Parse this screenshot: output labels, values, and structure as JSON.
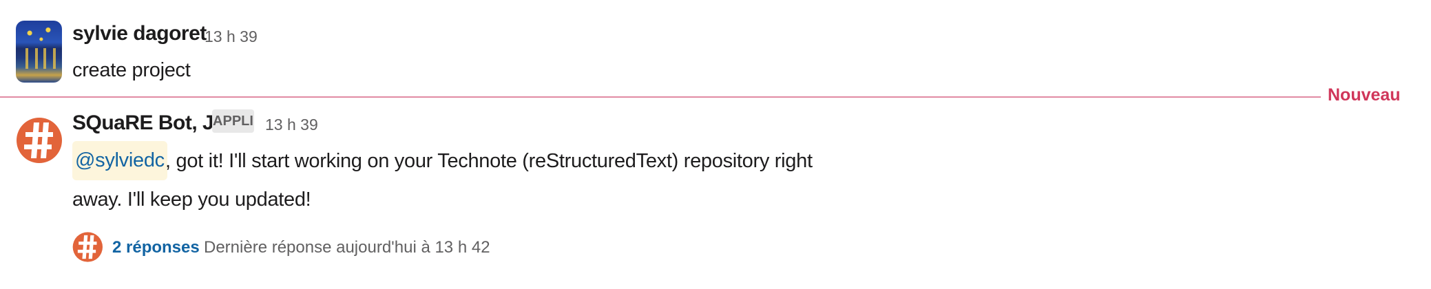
{
  "divider": {
    "label": "Nouveau",
    "color": "#e18aa3",
    "label_color": "#d0365a"
  },
  "messages": [
    {
      "author": "sylvie dagoret",
      "time": "13 h 39",
      "text": "create project",
      "avatar": "starry-night-painting-avatar"
    },
    {
      "author": "SQuaRE Bot, Jr.",
      "badge": "APPLI",
      "time": "13 h 39",
      "mention": "@sylviedc",
      "text_line1": ", got it! I'll start working on your Technote (reStructuredText) repository right",
      "text_line2": "away. I'll keep you updated!",
      "avatar": "hash-logo-icon",
      "accent": "#e2643a",
      "thread": {
        "replies": "2 réponses",
        "last_reply": "Dernière réponse aujourd'hui à 13 h 42"
      }
    }
  ]
}
